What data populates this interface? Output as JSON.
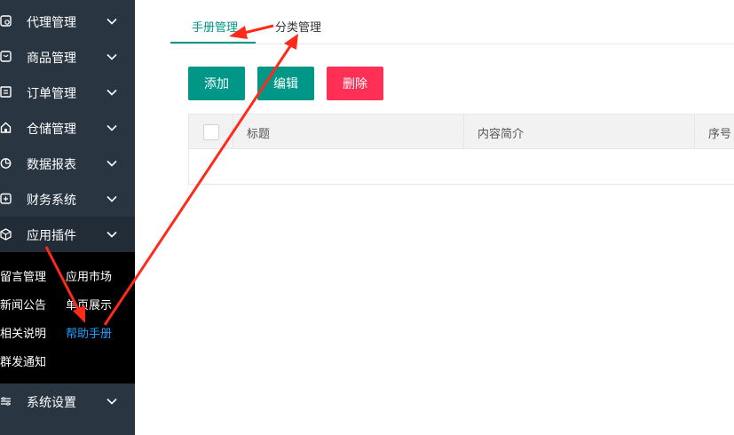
{
  "sidebar": {
    "items": [
      {
        "label": "代理管理",
        "icon": "agent-icon"
      },
      {
        "label": "商品管理",
        "icon": "goods-icon"
      },
      {
        "label": "订单管理",
        "icon": "order-icon"
      },
      {
        "label": "仓储管理",
        "icon": "warehouse-icon"
      },
      {
        "label": "数据报表",
        "icon": "report-icon"
      },
      {
        "label": "财务系统",
        "icon": "finance-icon"
      },
      {
        "label": "应用插件",
        "icon": "plugin-icon"
      },
      {
        "label": "系统设置",
        "icon": "settings-icon"
      }
    ],
    "submenu": [
      "留言管理",
      "应用市场",
      "新闻公告",
      "单页展示",
      "相关说明",
      "帮助手册",
      "群发通知"
    ],
    "current_submenu": "帮助手册"
  },
  "tabs": [
    "手册管理",
    "分类管理"
  ],
  "active_tab": "手册管理",
  "buttons": {
    "add": "添加",
    "edit": "编辑",
    "delete": "删除"
  },
  "table": {
    "columns": [
      "标题",
      "内容简介",
      "序号"
    ],
    "rows": []
  },
  "colors": {
    "sidebar_bg": "#2a3542",
    "submenu_bg": "#000000",
    "accent": "#009688",
    "danger": "#ff2f55",
    "highlight": "#1e9fff",
    "annotation_arrow": "#ff2a1a"
  }
}
